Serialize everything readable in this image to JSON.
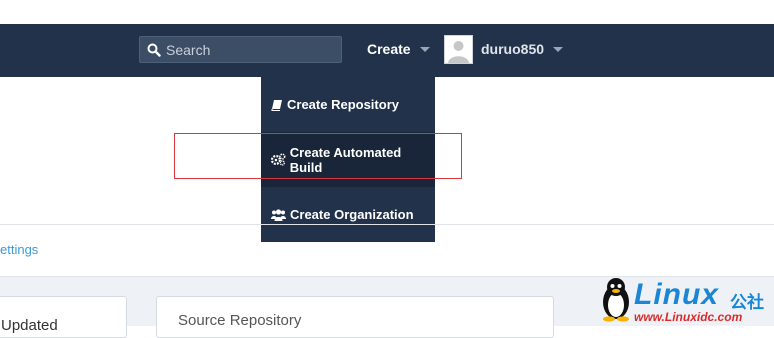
{
  "navbar": {
    "search_placeholder": "Search",
    "create_label": "Create",
    "username": "duruo850"
  },
  "dropdown": {
    "items": [
      {
        "label": "Create Repository",
        "icon": "book-icon"
      },
      {
        "label": "Create Automated Build",
        "icon": "gears-icon",
        "active": true
      },
      {
        "label": "Create Organization",
        "icon": "users-icon"
      }
    ]
  },
  "page": {
    "settings_link": "ettings",
    "card_left_title": "Updated",
    "card_right_title": "Source Repository"
  },
  "watermark": {
    "brand": "Linux",
    "brand_cn": "公社",
    "url": "www.Linuxidc.com"
  },
  "colors": {
    "navbar": "#22324b",
    "dropdown": "#22324b",
    "dropdown_active": "#192539",
    "highlight": "#d9363e",
    "link": "#3a9bd5",
    "watermark_blue": "#1b86d4",
    "watermark_red": "#d92b2b"
  }
}
